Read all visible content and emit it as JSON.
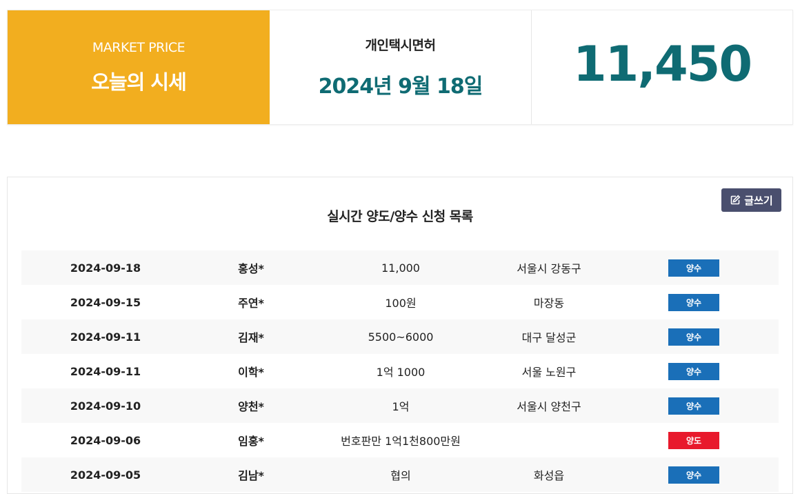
{
  "market": {
    "en_label": "MARKET PRICE",
    "ko_label": "오늘의 시세",
    "category": "개인택시면허",
    "date": "2024년 9월 18일",
    "price": "11,450"
  },
  "list": {
    "title": "실시간 양도/양수 신청 목록",
    "write_button": "글쓰기",
    "rows": [
      {
        "date": "2024-09-18",
        "name": "홍성*",
        "price": "11,000",
        "location": "서울시 강동구",
        "type": "양수",
        "kind": "buy"
      },
      {
        "date": "2024-09-15",
        "name": "주연*",
        "price": "100원",
        "location": "마장동",
        "type": "양수",
        "kind": "buy"
      },
      {
        "date": "2024-09-11",
        "name": "김재*",
        "price": "5500~6000",
        "location": "대구 달성군",
        "type": "양수",
        "kind": "buy"
      },
      {
        "date": "2024-09-11",
        "name": "이학*",
        "price": "1억 1000",
        "location": "서울 노원구",
        "type": "양수",
        "kind": "buy"
      },
      {
        "date": "2024-09-10",
        "name": "양천*",
        "price": "1억",
        "location": "서울시 양천구",
        "type": "양수",
        "kind": "buy"
      },
      {
        "date": "2024-09-06",
        "name": "임홍*",
        "price": "번호판만 1억1천800만원",
        "location": "",
        "type": "양도",
        "kind": "sell"
      },
      {
        "date": "2024-09-05",
        "name": "김남*",
        "price": "협의",
        "location": "화성읍",
        "type": "양수",
        "kind": "buy"
      }
    ]
  },
  "colors": {
    "accent_orange": "#f2ae1f",
    "teal": "#0f6b73",
    "buy_blue": "#1a6fb8",
    "sell_red": "#e8192c",
    "button_gray": "#4a4f6e"
  },
  "icons": {
    "write": "edit-icon"
  }
}
